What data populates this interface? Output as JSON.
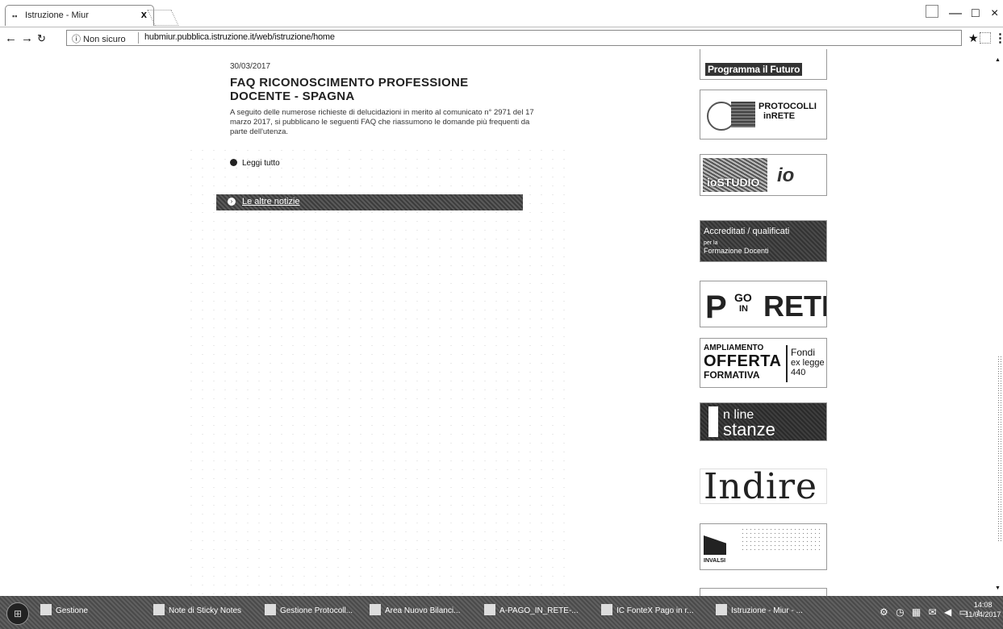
{
  "browser": {
    "tab_title": "Istruzione - Miur",
    "tab_close": "x",
    "tab_favicon": "▪▪",
    "security_label": "ⓘ Non sicuro",
    "url": "hubmiur.pubblica.istruzione.it/web/istruzione/home",
    "window_controls": {
      "minimize": "—",
      "maximize": "□",
      "close": "×"
    }
  },
  "news": {
    "date": "30/03/2017",
    "headline": "FAQ RICONOSCIMENTO PROFESSIONE DOCENTE - SPAGNA",
    "abstract": "A seguito delle numerose richieste di delucidazioni in merito al comunicato n° 2971 del 17 marzo 2017, si pubblicano le seguenti FAQ che riassumono le domande più frequenti da parte dell'utenza.",
    "read_more": "Leggi tutto",
    "other_news": "Le altre notizie"
  },
  "banners": {
    "programma_futuro": "Programma il Futuro",
    "protocolli_1": "PROTOCOLLI",
    "protocolli_2": "inRETE",
    "iostudio_1": "ioSTUDIO",
    "iostudio_2": "io",
    "accreditati_1": "Accreditati / qualificati",
    "accreditati_2": "per la",
    "accreditati_3": "Formazione Docenti",
    "pago_1": "P",
    "pago_2": "GO",
    "pago_3": "IN",
    "pago_4": "RETE",
    "ampliamento_1": "AMPLIAMENTO",
    "ampliamento_2": "OFFERTA",
    "ampliamento_3": "FORMATIVA",
    "ampliamento_4": "Fondi",
    "ampliamento_5": "ex legge",
    "ampliamento_6": "440",
    "istanze_1": "n line",
    "istanze_2": "stanze",
    "indire": "Indire",
    "invalsi": "INVALSI"
  },
  "taskbar": {
    "items": [
      "Gestione",
      "Note di Sticky Notes",
      "Gestione Protocoll...",
      "Area Nuovo Bilanci...",
      "A-PAGO_IN_RETE-...",
      "IC FonteX Pago in r...",
      "Istruzione - Miur - ..."
    ],
    "time": "14:08",
    "date": "11/04/2017"
  }
}
